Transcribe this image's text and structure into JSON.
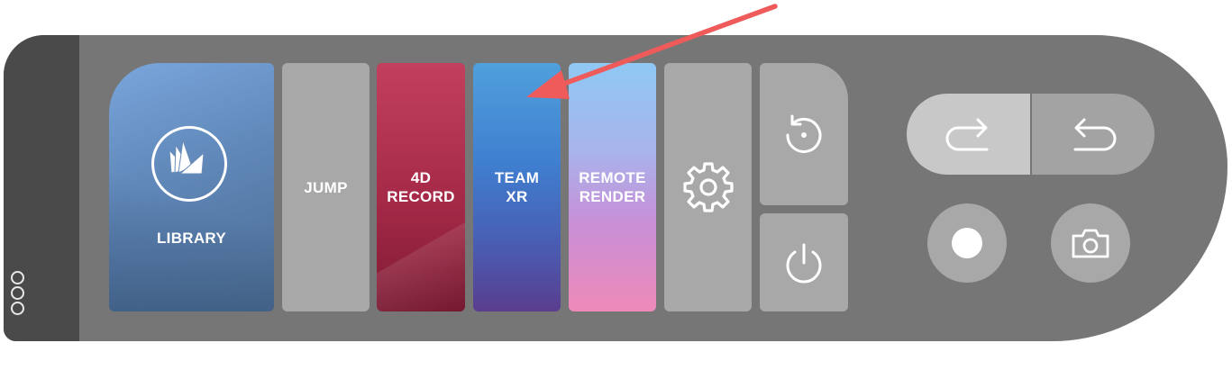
{
  "toolbar": {
    "tiles": {
      "library": "LIBRARY",
      "jump": "JUMP",
      "record": "4D\nRECORD",
      "team_xr": "TEAM\nXR",
      "remote_render": "REMOTE\nRENDER"
    },
    "icons": {
      "library": "library-book-icon",
      "settings": "gear-icon",
      "reset": "reset-icon",
      "power": "power-icon",
      "redo": "redo-icon",
      "undo": "undo-icon",
      "record": "record-dot-icon",
      "camera": "camera-icon",
      "menu": "three-dots-icon"
    }
  },
  "annotation": {
    "arrow_color": "#ef5b5b",
    "target": "team_xr"
  }
}
